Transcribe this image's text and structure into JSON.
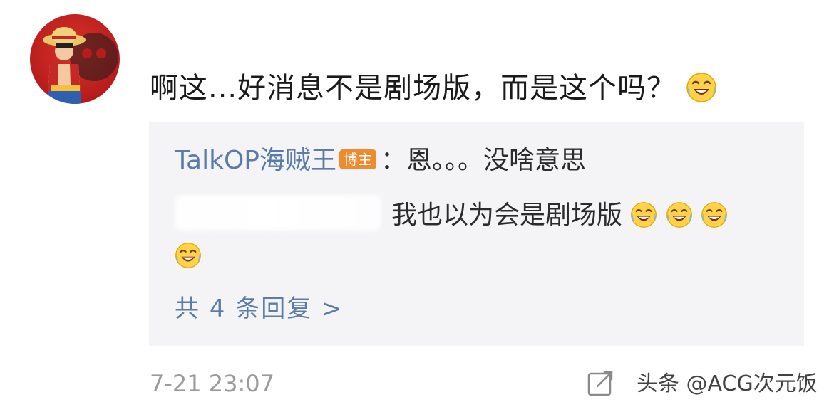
{
  "comment": {
    "text": "啊这...好消息不是剧场版，而是这个吗？",
    "emoji": "laugh-cry-icon"
  },
  "reply": {
    "author": "TalkOP海贼王",
    "badge": "博主",
    "first_reply": "：恩。。。没啥意思",
    "second_reply_text": "我也以为会是剧场版",
    "more_replies": "共 4 条回复 >"
  },
  "footer": {
    "timestamp": "7-21 23:07",
    "watermark": "头条 @ACG次元饭"
  },
  "colors": {
    "link_blue": "#5b7ca8",
    "badge_orange": "#f08a2e",
    "reply_bg": "#f4f4f6"
  }
}
